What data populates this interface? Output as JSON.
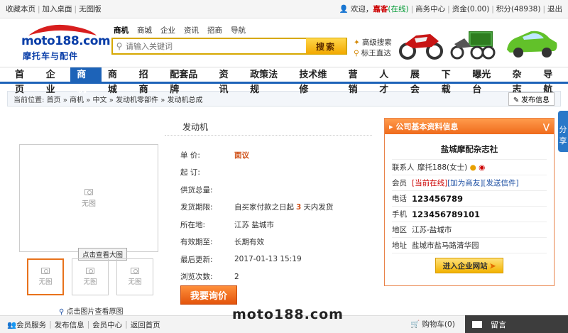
{
  "topbar": {
    "left_links": [
      "收藏本页",
      "加入桌面",
      "无图版"
    ],
    "welcome": "欢迎，",
    "guest_name": "嘉客",
    "online_status": "(在线)",
    "right_links": [
      "商务中心",
      "资金(0.00)",
      "积分(48938)",
      "退出"
    ]
  },
  "logo": {
    "url_text": "moto188.com",
    "cn_text": "摩托车与配件"
  },
  "search": {
    "tabs": [
      "商机",
      "商城",
      "企业",
      "资讯",
      "招商",
      "导航"
    ],
    "active_tab": "商机",
    "placeholder": "请输入关键词",
    "button_label": "搜索",
    "advanced": "高级搜索",
    "label_direct": "标王直达"
  },
  "nav": {
    "items": [
      "首页",
      "企业",
      "商机",
      "商城",
      "招商",
      "配套品牌",
      "资讯",
      "政策法规",
      "技术维修",
      "营销",
      "人才",
      "展会",
      "下载",
      "曝光台",
      "杂志",
      "导航"
    ],
    "active": "商机"
  },
  "breadcrumb": {
    "prefix": "当前位置:",
    "items": [
      "首页",
      "商机",
      "中文",
      "发动机零部件",
      "发动机总成"
    ],
    "publish_button": "发布信息"
  },
  "product": {
    "title": "发动机",
    "no_image": "无图",
    "zoom_tip": "点击查看大图",
    "view_original": "点击图片查看原图",
    "fields": [
      {
        "label": "单 价:",
        "value": "面议"
      },
      {
        "label": "起 订:",
        "value": ""
      },
      {
        "label": "供货总量:",
        "value": ""
      },
      {
        "label": "发货期限:",
        "value_pre": "自买家付款之日起",
        "value_num": "3",
        "value_post": "天内发货"
      },
      {
        "label": "所在地:",
        "value": "江苏 盐城市"
      },
      {
        "label": "有效期至:",
        "value": "长期有效"
      },
      {
        "label": "最后更新:",
        "value": "2017-01-13 15:19"
      },
      {
        "label": "浏览次数:",
        "value": "2"
      }
    ],
    "inquire_button": "我要询价"
  },
  "company": {
    "header": "公司基本资料信息",
    "name": "盐城摩配杂志社",
    "contact_label": "联系人",
    "contact_value": "摩托188(女士)",
    "member_label": "会员",
    "member_online": "[当前在线]",
    "member_friend": "[加为商友]",
    "member_mail": "[发送信件]",
    "phone_label": "电话",
    "phone_value": "123456789",
    "mobile_label": "手机",
    "mobile_value": "123456789101",
    "area_label": "地区",
    "area_value": "江苏-盐城市",
    "address_label": "地址",
    "address_value": "盐城市盐马路清华园",
    "enter_button": "进入企业网站"
  },
  "side_tab": "分享",
  "footer": {
    "links": [
      "会员服务",
      "发布信息",
      "会员中心",
      "返回首页"
    ],
    "cart": "购物车(0)",
    "message": "留言"
  },
  "watermark": "moto188.com",
  "colors": {
    "nav_blue": "#1d63b8",
    "accent_orange": "#ef6b1c",
    "price_red": "#d0521a"
  }
}
